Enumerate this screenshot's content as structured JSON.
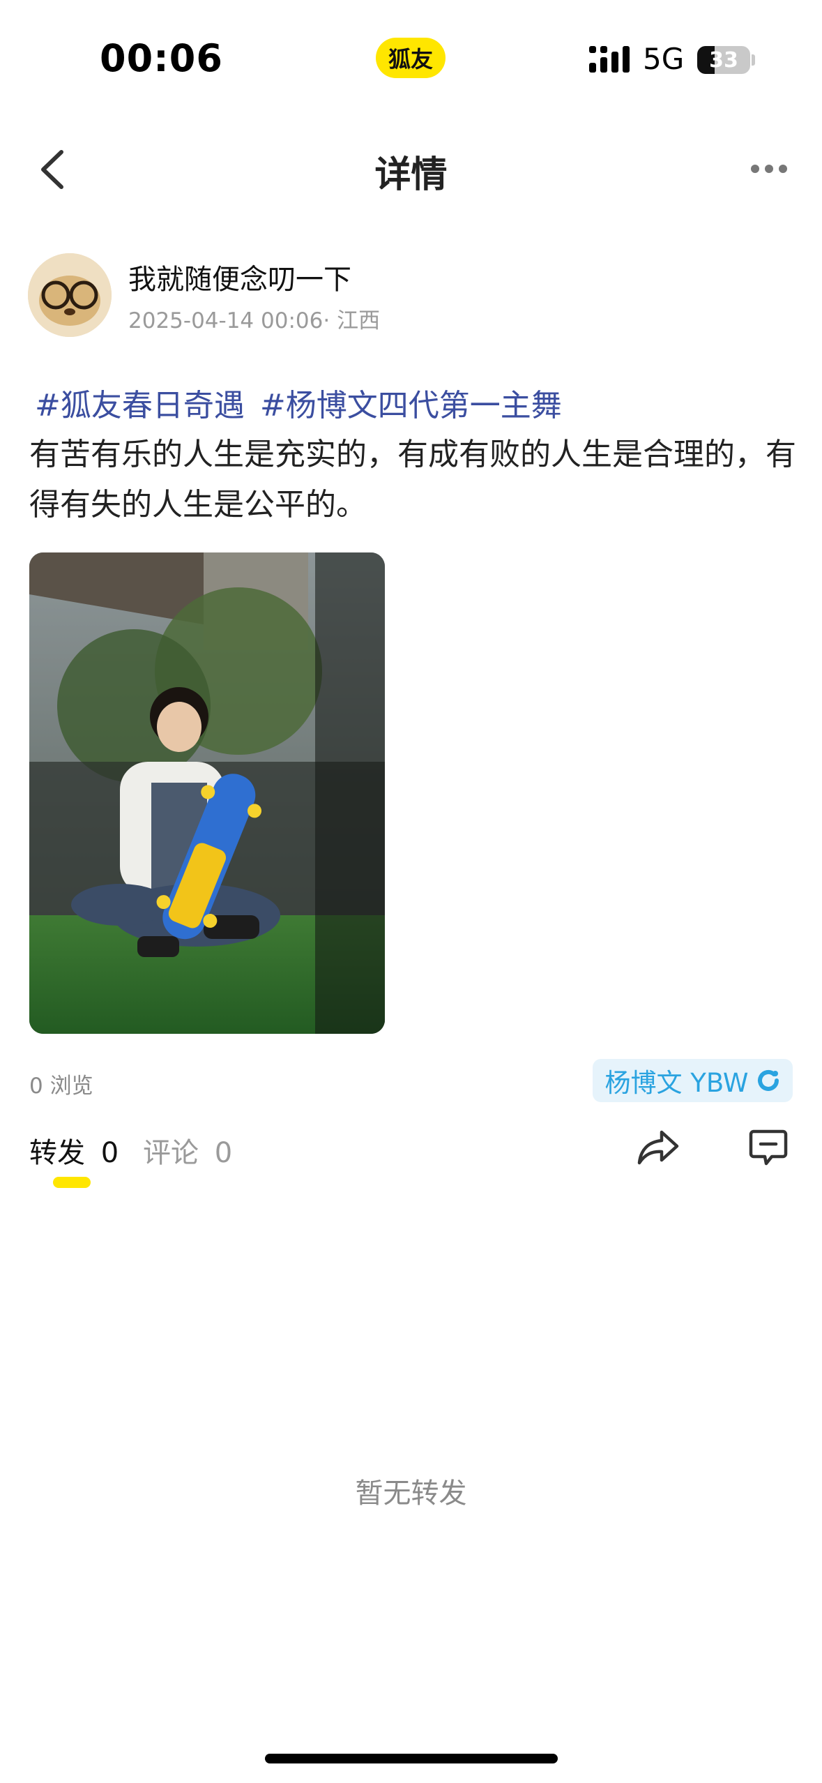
{
  "status_bar": {
    "time": "00:06",
    "app_badge": "狐友",
    "network": "5G",
    "battery": "33",
    "battery_level": 0.33,
    "signal_icon": "signal-bars-icon"
  },
  "nav": {
    "title": "详情",
    "back_icon": "chevron-left-icon",
    "more_icon": "more-dots-icon"
  },
  "author": {
    "name": "我就随便念叨一下",
    "timestamp": "2025-04-14 00:06",
    "location": "· 江西"
  },
  "post": {
    "tags": [
      "#狐友春日奇遇",
      "#杨博文四代第一主舞"
    ],
    "text": "有苦有乐的人生是充实的，有成有败的人生是合理的，有得有失的人生是公平的。"
  },
  "stats": {
    "views": "0 浏览",
    "topic_chip": "杨博文 YBW",
    "topic_chip_icon": "refresh-ring-icon"
  },
  "tabs": {
    "repost_label": "转发",
    "repost_count": "0",
    "comment_label": "评论",
    "comment_count": "0",
    "share_icon": "share-arrow-icon",
    "comment_icon": "comment-bubble-icon"
  },
  "empty_state": "暂无转发",
  "colors": {
    "accent_yellow": "#ffe600",
    "tag_blue": "#3b4ea0",
    "chip_blue": "#2aa3e0"
  }
}
